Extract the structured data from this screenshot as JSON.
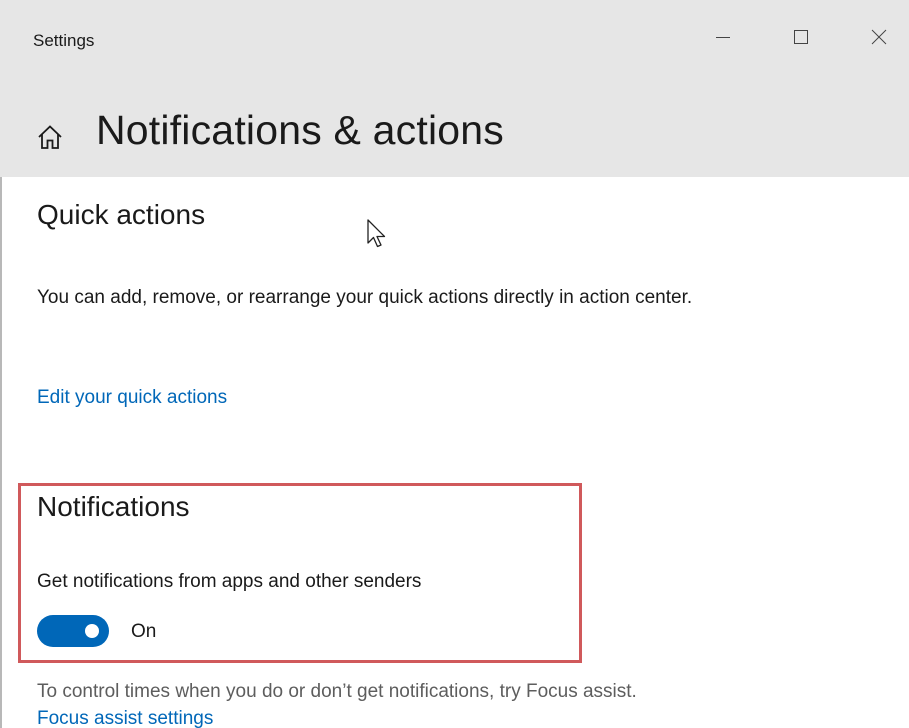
{
  "window": {
    "title": "Settings",
    "controls": {
      "minimize_icon": "minimize-icon",
      "maximize_icon": "maximize-icon",
      "close_icon": "close-icon"
    }
  },
  "header": {
    "icon": "home-icon",
    "title": "Notifications & actions"
  },
  "quick_actions": {
    "heading": "Quick actions",
    "description": "You can add, remove, or rearrange your quick actions directly in action center.",
    "edit_link": "Edit your quick actions"
  },
  "notifications": {
    "heading": "Notifications",
    "label": "Get notifications from apps and other senders",
    "toggle_state": "On",
    "toggle_on": true
  },
  "focus_assist": {
    "text": "To control times when you do or don’t get notifications, try Focus assist.",
    "link": "Focus assist settings"
  },
  "colors": {
    "accent": "#0067b8",
    "highlight_border": "#d0595b",
    "header_background": "#e6e6e6"
  }
}
